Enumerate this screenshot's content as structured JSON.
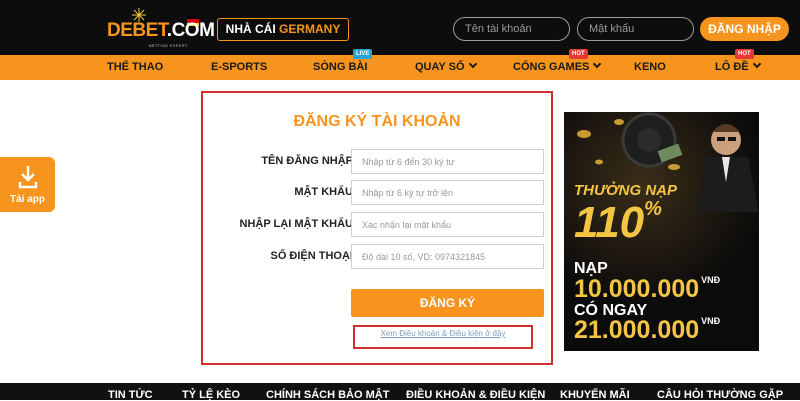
{
  "header": {
    "logo_text_main": "DEBET",
    "logo_text_suffix": ".COM",
    "logo_subtitle": "BETTING EXPERT",
    "brand_prefix": "NHÀ CÁI",
    "brand_highlight": "GERMANY",
    "username_placeholder": "Tên tài khoản",
    "password_placeholder": "Mật khẩu",
    "login_label": "ĐĂNG NHẬP"
  },
  "nav": {
    "items": [
      {
        "label": "THỂ THAO",
        "icon": "",
        "badge": ""
      },
      {
        "label": "E-SPORTS",
        "icon": "",
        "badge": ""
      },
      {
        "label": "SÒNG BÀI",
        "icon": "",
        "badge": "LIVE"
      },
      {
        "label": "QUAY SỐ",
        "icon": "chevron-down-icon",
        "badge": ""
      },
      {
        "label": "CỔNG GAMES",
        "icon": "chevron-down-icon",
        "badge": "HOT"
      },
      {
        "label": "KENO",
        "icon": "",
        "badge": ""
      },
      {
        "label": "LÔ ĐỀ",
        "icon": "chevron-down-icon",
        "badge": "HOT"
      }
    ]
  },
  "side": {
    "app_label": "Tải app",
    "app_icon": "download-icon"
  },
  "register": {
    "title": "ĐĂNG KÝ TÀI KHOẢN",
    "fields": [
      {
        "label": "TÊN ĐĂNG NHẬP",
        "placeholder": "Nhập từ 6 đến 30 ký tự"
      },
      {
        "label": "MẬT KHẨU",
        "placeholder": "Nhập từ 6 ký tự trở lên"
      },
      {
        "label": "NHẬP LẠI MẬT KHẨU",
        "placeholder": "Xác nhận lại mật khẩu"
      },
      {
        "label": "SỐ ĐIỆN THOẠI",
        "placeholder": "Độ dài 10 số, VD: 0974321845"
      }
    ],
    "submit_label": "ĐĂNG KÝ",
    "terms_label": "Xem Điều khoản & Điều kiện ở đây"
  },
  "promo": {
    "line1": "THƯỞNG NẠP",
    "line2": "110",
    "line2_suffix": "%",
    "line3": "NẠP",
    "line4": "10.000.000",
    "line5": "CÓ NGAY",
    "line6": "21.000.000",
    "currency": "VNĐ"
  },
  "footer": {
    "items": [
      "TIN TỨC",
      "TỶ LỆ KÈO",
      "CHÍNH SÁCH BẢO MẬT",
      "ĐIỀU KHOẢN & ĐIỀU KIỆN",
      "KHUYẾN MÃI",
      "CÂU HỎI THƯỜNG GẶP"
    ]
  },
  "colors": {
    "accent": "#f7941d",
    "header_bg": "#0d0d0d",
    "highlight_border": "#d32f2f",
    "promo_gold": "#f4c542"
  }
}
